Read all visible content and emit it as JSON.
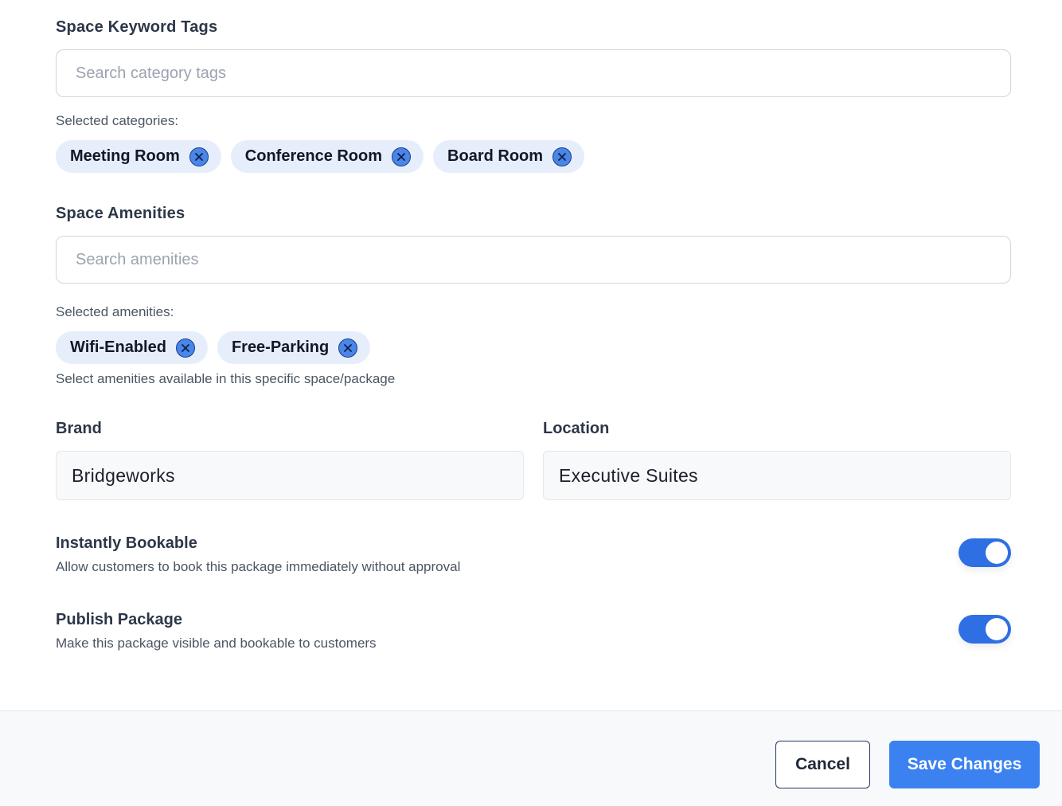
{
  "keyword_tags": {
    "label": "Space Keyword Tags",
    "placeholder": "Search category tags",
    "selected_label": "Selected categories:",
    "chips": [
      {
        "label": "Meeting Room"
      },
      {
        "label": "Conference Room"
      },
      {
        "label": "Board Room"
      }
    ]
  },
  "amenities": {
    "label": "Space Amenities",
    "placeholder": "Search amenities",
    "selected_label": "Selected amenities:",
    "chips": [
      {
        "label": "Wifi-Enabled"
      },
      {
        "label": "Free-Parking"
      }
    ],
    "helper": "Select amenities available in this specific space/package"
  },
  "brand": {
    "label": "Brand",
    "value": "Bridgeworks"
  },
  "location": {
    "label": "Location",
    "value": "Executive Suites"
  },
  "instantly_bookable": {
    "title": "Instantly Bookable",
    "description": "Allow customers to book this package immediately without approval",
    "enabled": true
  },
  "publish_package": {
    "title": "Publish Package",
    "description": "Make this package visible and bookable to customers",
    "enabled": true
  },
  "footer": {
    "cancel_label": "Cancel",
    "save_label": "Save Changes"
  },
  "colors": {
    "accent": "#3b82f0",
    "chip_bg": "#e6eefb",
    "toggle_on": "#2f6fe4"
  },
  "icons": {
    "chip_remove": "close-circle-icon"
  }
}
